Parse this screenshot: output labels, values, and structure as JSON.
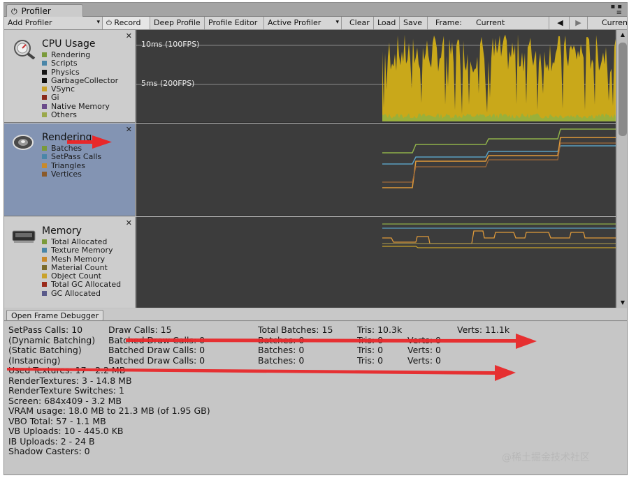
{
  "window": {
    "tab_title": "Profiler"
  },
  "toolbar": {
    "add_profiler": "Add Profiler",
    "record": "Record",
    "deep_profile": "Deep Profile",
    "profile_editor": "Profile Editor",
    "active_profiler": "Active Profiler",
    "clear": "Clear",
    "load": "Load",
    "save": "Save",
    "frame_label": "Frame:",
    "frame_value": "Current",
    "current_btn": "Current"
  },
  "panels": [
    {
      "title": "CPU Usage",
      "icon": "cpu-usage-icon",
      "legend": [
        {
          "label": "Rendering",
          "color": "#7a9a3a"
        },
        {
          "label": "Scripts",
          "color": "#4a86a8"
        },
        {
          "label": "Physics",
          "color": "#151515"
        },
        {
          "label": "GarbageCollector",
          "color": "#111111"
        },
        {
          "label": "VSync",
          "color": "#c9a22a"
        },
        {
          "label": "Gi",
          "color": "#8a2a1a"
        },
        {
          "label": "Native Memory",
          "color": "#6a4a8a"
        },
        {
          "label": "Others",
          "color": "#9aa84a"
        }
      ],
      "fps_lines": [
        "10ms (100FPS)",
        "5ms (200FPS)"
      ]
    },
    {
      "title": "Rendering",
      "icon": "rendering-icon",
      "legend": [
        {
          "label": "Batches",
          "color": "#7a9a3a"
        },
        {
          "label": "SetPass Calls",
          "color": "#4a86a8"
        },
        {
          "label": "Triangles",
          "color": "#c98a2a"
        },
        {
          "label": "Vertices",
          "color": "#8a5a2a"
        }
      ]
    },
    {
      "title": "Memory",
      "icon": "memory-icon",
      "legend": [
        {
          "label": "Total Allocated",
          "color": "#7a9a3a"
        },
        {
          "label": "Texture Memory",
          "color": "#4a86a8"
        },
        {
          "label": "Mesh Memory",
          "color": "#c98a2a"
        },
        {
          "label": "Material Count",
          "color": "#7a6a2a"
        },
        {
          "label": "Object Count",
          "color": "#c9a22a"
        },
        {
          "label": "Total GC Allocated",
          "color": "#9a2a1a"
        },
        {
          "label": "GC Allocated",
          "color": "#5a5a8a"
        }
      ]
    }
  ],
  "bottom": {
    "frame_debugger": "Open Frame Debugger"
  },
  "stats": {
    "row1": [
      "SetPass Calls: 10",
      "Draw Calls: 15",
      "Total Batches: 15",
      "Tris: 10.3k",
      "Verts: 11.1k"
    ],
    "row2": [
      "(Dynamic Batching)",
      "Batched Draw Calls: 0",
      "Batches: 0",
      "Tris: 0",
      "Verts: 0"
    ],
    "row3": [
      "(Static Batching)",
      "Batched Draw Calls: 0",
      "Batches: 0",
      "Tris: 0",
      "Verts: 0"
    ],
    "row4": [
      "(Instancing)",
      "Batched Draw Calls: 0",
      "Batches: 0",
      "Tris: 0",
      "Verts: 0"
    ],
    "lines": [
      "Used Textures: 17 - 2.2 MB",
      "RenderTextures: 3 - 14.8 MB",
      "RenderTexture Switches: 1",
      "Screen: 684x409 - 3.2 MB",
      "VRAM usage: 18.0 MB to 21.3 MB (of 1.95 GB)",
      "VBO Total: 57 - 1.1 MB",
      "VB Uploads: 10 - 445.0 KB",
      "IB Uploads: 2 - 24 B",
      "Shadow Casters: 0"
    ]
  },
  "annotations": {
    "arrow_color": "#e8282a"
  },
  "watermark": "@稀土掘金技术社区"
}
